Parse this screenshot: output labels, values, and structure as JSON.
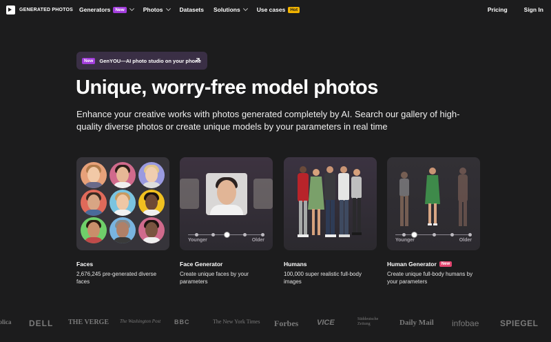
{
  "nav": {
    "brand": "GENERATED PHOTOS",
    "items": [
      {
        "label": "Generators",
        "badge": "New",
        "badge_type": "new",
        "dropdown": true
      },
      {
        "label": "Photos",
        "badge": null,
        "dropdown": true
      },
      {
        "label": "Datasets",
        "badge": null,
        "dropdown": false
      },
      {
        "label": "Solutions",
        "badge": null,
        "dropdown": true
      },
      {
        "label": "Use cases",
        "badge": "Hot",
        "badge_type": "hot",
        "dropdown": false
      }
    ],
    "pricing": "Pricing",
    "signin": "Sign In"
  },
  "promo": {
    "badge": "New",
    "text": "GenYOU—AI photo studio on your phone"
  },
  "hero": {
    "title": "Unique, worry-free model photos",
    "subtitle": "Enhance your creative works with photos generated completely by AI. Search our gallery of high-quality diverse photos or create unique models by your parameters in real time"
  },
  "cards": [
    {
      "title": "Faces",
      "badge": null,
      "desc": "2,676,245 pre-generated diverse faces"
    },
    {
      "title": "Face Generator",
      "badge": null,
      "desc": "Create unique faces by your parameters",
      "slider_left": "Younger",
      "slider_right": "Older"
    },
    {
      "title": "Humans",
      "badge": null,
      "desc": "100,000 super realistic full-body images"
    },
    {
      "title": "Human Generator",
      "badge": "New",
      "desc": "Create unique full-body humans by your parameters",
      "slider_left": "Younger",
      "slider_right": "Older"
    }
  ],
  "press": [
    "blica",
    "DELL",
    "THE VERGE",
    "The Washington Post",
    "BBC",
    "The New York Times",
    "Forbes",
    "VICE",
    "Süddeutsche Zeitung",
    "Daily Mail",
    "infobae",
    "SPIEGEL"
  ],
  "colors": {
    "background": "#1c1c1d",
    "badge_new": "#a23ddc",
    "badge_hot": "#f2b400",
    "badge_new_red": "#e1456f"
  }
}
